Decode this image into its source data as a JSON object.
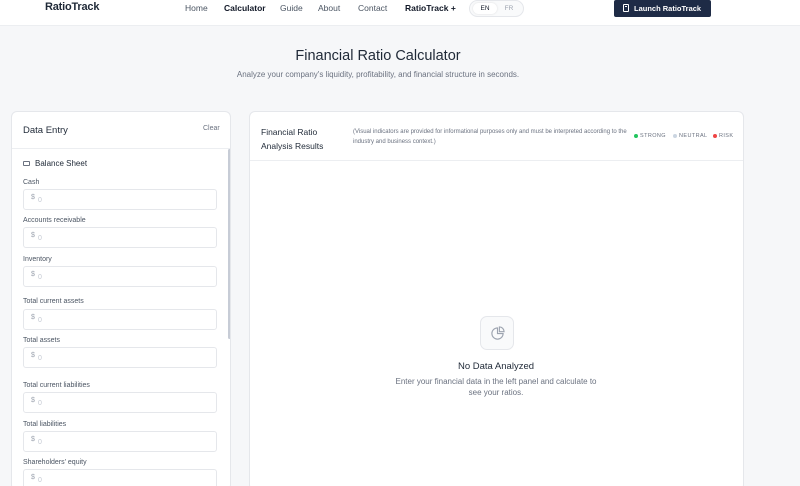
{
  "nav": {
    "brand": "RatioTrack",
    "links": [
      "Home",
      "Calculator",
      "Guide",
      "About",
      "Contact",
      "RatioTrack +"
    ],
    "active": "Calculator",
    "lang_options": [
      "EN",
      "FR"
    ],
    "lang_selected": "EN",
    "launch_label": "Launch RatioTrack"
  },
  "hero": {
    "title": "Financial Ratio Calculator",
    "subtitle": "Analyze your company's liquidity, profitability, and financial structure in seconds."
  },
  "entry": {
    "title": "Data Entry",
    "clear_label": "Clear",
    "section": "Balance Sheet",
    "currency": "$",
    "fields": [
      {
        "label": "Cash",
        "placeholder": "0"
      },
      {
        "label": "Accounts receivable",
        "placeholder": "0"
      },
      {
        "label": "Inventory",
        "placeholder": "0"
      },
      {
        "label": "Total current assets",
        "placeholder": "0"
      },
      {
        "label": "Total assets",
        "placeholder": "0"
      },
      {
        "label": "Total current liabilities",
        "placeholder": "0"
      },
      {
        "label": "Total liabilities",
        "placeholder": "0"
      },
      {
        "label": "Shareholders' equity",
        "placeholder": "0"
      }
    ]
  },
  "results": {
    "title": "Financial Ratio Analysis Results",
    "note": "(Visual indicators are provided for informational purposes only and must be interpreted according to the industry and business context.)",
    "legend": [
      {
        "label": "STRONG",
        "color": "#22c55e"
      },
      {
        "label": "NEUTRAL",
        "color": "#cbd5e1"
      },
      {
        "label": "RISK",
        "color": "#ef4444"
      }
    ],
    "empty_title": "No Data Analyzed",
    "empty_text": "Enter your financial data in the left panel and calculate to see your ratios."
  },
  "colors": {
    "accent": "#1e2b46",
    "background": "#f6f7f9"
  }
}
